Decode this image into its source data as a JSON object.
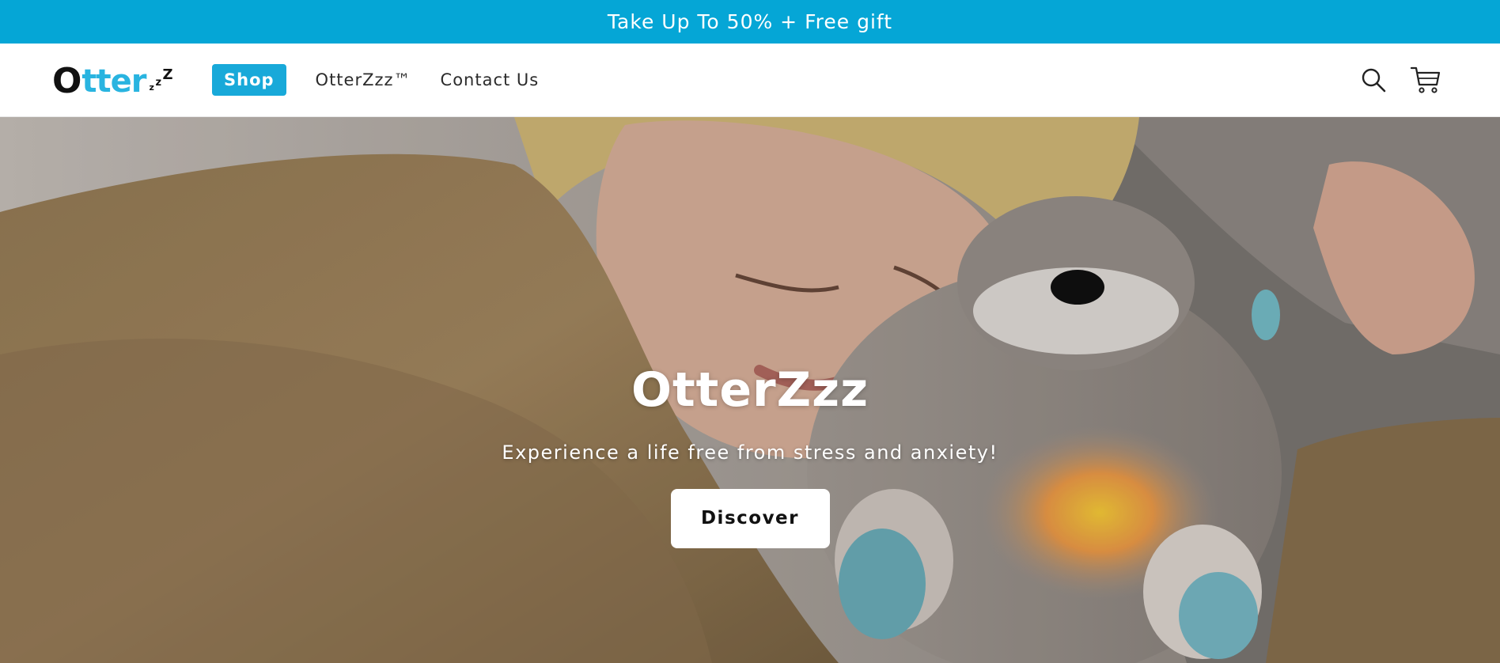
{
  "announcement": {
    "text": "Take Up To 50% + Free gift"
  },
  "brand": {
    "logo_main": "O",
    "logo_rest": "tter",
    "logo_z1": "z",
    "logo_z2": "z",
    "logo_z3": "Z",
    "accent": "#05a6d6"
  },
  "nav": {
    "items": [
      {
        "label": "Shop",
        "active": true
      },
      {
        "label": "OtterZzz™",
        "active": false
      },
      {
        "label": "Contact Us",
        "active": false
      }
    ]
  },
  "header_icons": {
    "search": "search-icon",
    "cart": "cart-icon"
  },
  "hero": {
    "title": "OtterZzz",
    "subtitle": "Experience a life free from stress and anxiety!",
    "button_label": "Discover"
  }
}
